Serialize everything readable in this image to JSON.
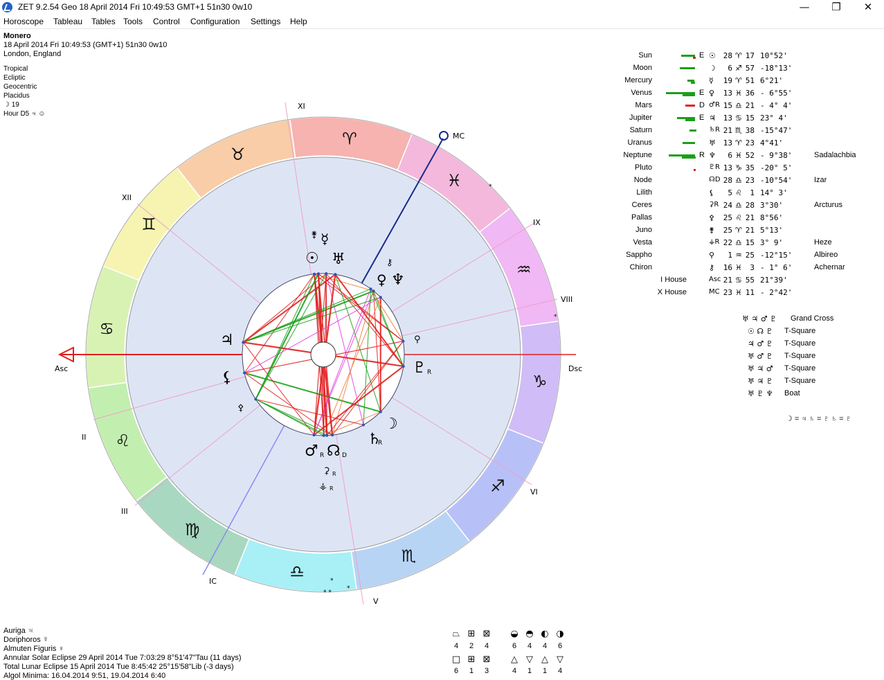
{
  "window": {
    "title": "ZET 9.2.54 Geo   18 April 2014  Fri  10:49:53 GMT+1 51n30  0w10",
    "min_label": "—",
    "max_label": "❐",
    "close_label": "✕"
  },
  "menu": [
    "Horoscope",
    "Tableau",
    "Tables",
    "Tools",
    "Control",
    "Configuration",
    "Settings",
    "Help"
  ],
  "chart_info": {
    "name": "Monero",
    "datetime": "18 April 2014  Fri  10:49:53 (GMT+1) 51n30  0w10",
    "place": "London, England",
    "zodiac": "Tropical",
    "coords": "Ecliptic",
    "view": "Geocentric",
    "houses": "Placidus",
    "moon_line": "☽  19",
    "hour_line": "Hour D5  ♃ ☺"
  },
  "wheel": {
    "houses": [
      "XI",
      "XII",
      "IX",
      "VIII",
      "VI",
      "V",
      "IV",
      "III",
      "II"
    ],
    "house_labels": {
      "xi": "XI",
      "xii": "XII",
      "ix": "IX",
      "viii": "VIII",
      "vi": "VI",
      "v": "V",
      "iii": "III",
      "ii": "II"
    },
    "asc": "Asc",
    "dsc": "Dsc",
    "mc": "MC",
    "ic": "IC",
    "signs": [
      "♈",
      "♉",
      "♊",
      "♋",
      "♌",
      "♍",
      "♎",
      "♏",
      "♐",
      "♑",
      "♒",
      "♓"
    ]
  },
  "planets": [
    {
      "name": "Sun",
      "flag": "E",
      "glyph": "☉",
      "deg": "28",
      "sign": "♈",
      "min": "17",
      "lat": "10°52'",
      "star": ""
    },
    {
      "name": "Moon",
      "flag": "",
      "glyph": "☽",
      "deg": "6",
      "sign": "♐",
      "min": "57",
      "lat": "-18°13'",
      "star": ""
    },
    {
      "name": "Mercury",
      "flag": "",
      "glyph": "☿",
      "deg": "19",
      "sign": "♈",
      "min": "51",
      "lat": "6°21'",
      "star": ""
    },
    {
      "name": "Venus",
      "flag": "E",
      "glyph": "♀",
      "deg": "13",
      "sign": "♓",
      "min": "36",
      "lat": "- 6°55'",
      "star": ""
    },
    {
      "name": "Mars",
      "flag": "D",
      "glyph": "♂R",
      "deg": "15",
      "sign": "♎",
      "min": "21",
      "lat": "- 4° 4'",
      "star": ""
    },
    {
      "name": "Jupiter",
      "flag": "E",
      "glyph": "♃",
      "deg": "13",
      "sign": "♋",
      "min": "15",
      "lat": "23° 4'",
      "star": ""
    },
    {
      "name": "Saturn",
      "flag": "",
      "glyph": "♄R",
      "deg": "21",
      "sign": "♏",
      "min": "38",
      "lat": "-15°47'",
      "star": ""
    },
    {
      "name": "Uranus",
      "flag": "",
      "glyph": "♅",
      "deg": "13",
      "sign": "♈",
      "min": "23",
      "lat": "4°41'",
      "star": ""
    },
    {
      "name": "Neptune",
      "flag": "R",
      "glyph": "♆",
      "deg": "6",
      "sign": "♓",
      "min": "52",
      "lat": "- 9°38'",
      "star": "Sadalachbia"
    },
    {
      "name": "Pluto",
      "flag": "",
      "glyph": "♇R",
      "deg": "13",
      "sign": "♑",
      "min": "35",
      "lat": "-20° 5'",
      "star": ""
    },
    {
      "name": "Node",
      "flag": "",
      "glyph": "☊D",
      "deg": "28",
      "sign": "♎",
      "min": "23",
      "lat": "-10°54'",
      "star": "Izar"
    },
    {
      "name": "Lilith",
      "flag": "",
      "glyph": "⚸",
      "deg": "5",
      "sign": "♌",
      "min": "1",
      "lat": "14° 3'",
      "star": ""
    },
    {
      "name": "Ceres",
      "flag": "",
      "glyph": "⚳R",
      "deg": "24",
      "sign": "♎",
      "min": "28",
      "lat": "3°30'",
      "star": "Arcturus"
    },
    {
      "name": "Pallas",
      "flag": "",
      "glyph": "⚴",
      "deg": "25",
      "sign": "♌",
      "min": "21",
      "lat": "8°56'",
      "star": ""
    },
    {
      "name": "Juno",
      "flag": "",
      "glyph": "⚵",
      "deg": "25",
      "sign": "♈",
      "min": "21",
      "lat": "5°13'",
      "star": ""
    },
    {
      "name": "Vesta",
      "flag": "",
      "glyph": "⚶R",
      "deg": "22",
      "sign": "♎",
      "min": "15",
      "lat": "3° 9'",
      "star": "Heze"
    },
    {
      "name": "Sappho",
      "flag": "",
      "glyph": "⚲",
      "deg": "1",
      "sign": "♒",
      "min": "25",
      "lat": "-12°15'",
      "star": "Albireo"
    },
    {
      "name": "Chiron",
      "flag": "",
      "glyph": "⚷",
      "deg": "16",
      "sign": "♓",
      "min": "3",
      "lat": "- 1° 6'",
      "star": "Achernar"
    },
    {
      "name": "I House",
      "flag": "",
      "glyph": "Asc",
      "deg": "21",
      "sign": "♋",
      "min": "55",
      "lat": "21°39'",
      "star": ""
    },
    {
      "name": "X House",
      "flag": "",
      "glyph": "MC",
      "deg": "23",
      "sign": "♓",
      "min": "11",
      "lat": "- 2°42'",
      "star": ""
    }
  ],
  "configurations": [
    {
      "glyphs": "♅ ♃ ♂ ♇",
      "label": "Grand Cross"
    },
    {
      "glyphs": "☉ ☊ ♇",
      "label": "T-Square"
    },
    {
      "glyphs": "♃ ♂ ♇",
      "label": "T-Square"
    },
    {
      "glyphs": "♅ ♂ ♇",
      "label": "T-Square"
    },
    {
      "glyphs": "♅ ♃ ♂",
      "label": "T-Square"
    },
    {
      "glyphs": "♅ ♃ ♇",
      "label": "T-Square"
    },
    {
      "glyphs": "♅ ♇ ♆",
      "label": "Boat"
    }
  ],
  "midpoint_line": "☽ = ♃  ♄ = ♇ ♄ = ♇",
  "bottom": {
    "auriga": "Auriga  ♃",
    "doriphoros": "Doriphoros  ☿",
    "almuten": "Almuten Figuris  ♀",
    "solar_eclipse": "Annular Solar Eclipse 29 April 2014 Tue  7:03:29  8°51'47\"Tau (11 days)",
    "lunar_eclipse": "Total Lunar Eclipse 15 April 2014 Tue  8:45:42 25°15'58\"Lib (-3 days)",
    "algol": "Algol Minima: 16.04.2014  9:51,  19.04.2014  6:40"
  },
  "quad_counts": {
    "top": [
      "4",
      "2",
      "4",
      "6",
      "4",
      "4",
      "6"
    ],
    "bottom": [
      "6",
      "1",
      "3",
      "4",
      "1",
      "1",
      "4"
    ],
    "top_icons": [
      "⏢",
      "⊞",
      "⊠",
      "◒",
      "◓",
      "◐",
      "◑"
    ],
    "bottom_icons": [
      "□",
      "⊞",
      "⊠",
      "△",
      "▽",
      "△",
      "▽"
    ]
  },
  "colors": {
    "aries": "#f6b3b0",
    "taurus": "#f8cda8",
    "gemini": "#f6f4b0",
    "cancer": "#d8f2b4",
    "leo": "#c2efb0",
    "virgo": "#a8d8c0",
    "libra": "#a8f0f6",
    "scorpio": "#b8d4f4",
    "sagittarius": "#b8c0f8",
    "capricorn": "#d0bcf6",
    "aquarius": "#f0b8f4",
    "pisces": "#f4b8dc",
    "inner": "#dce4f4",
    "green": "#19a019",
    "red": "#e02020"
  }
}
